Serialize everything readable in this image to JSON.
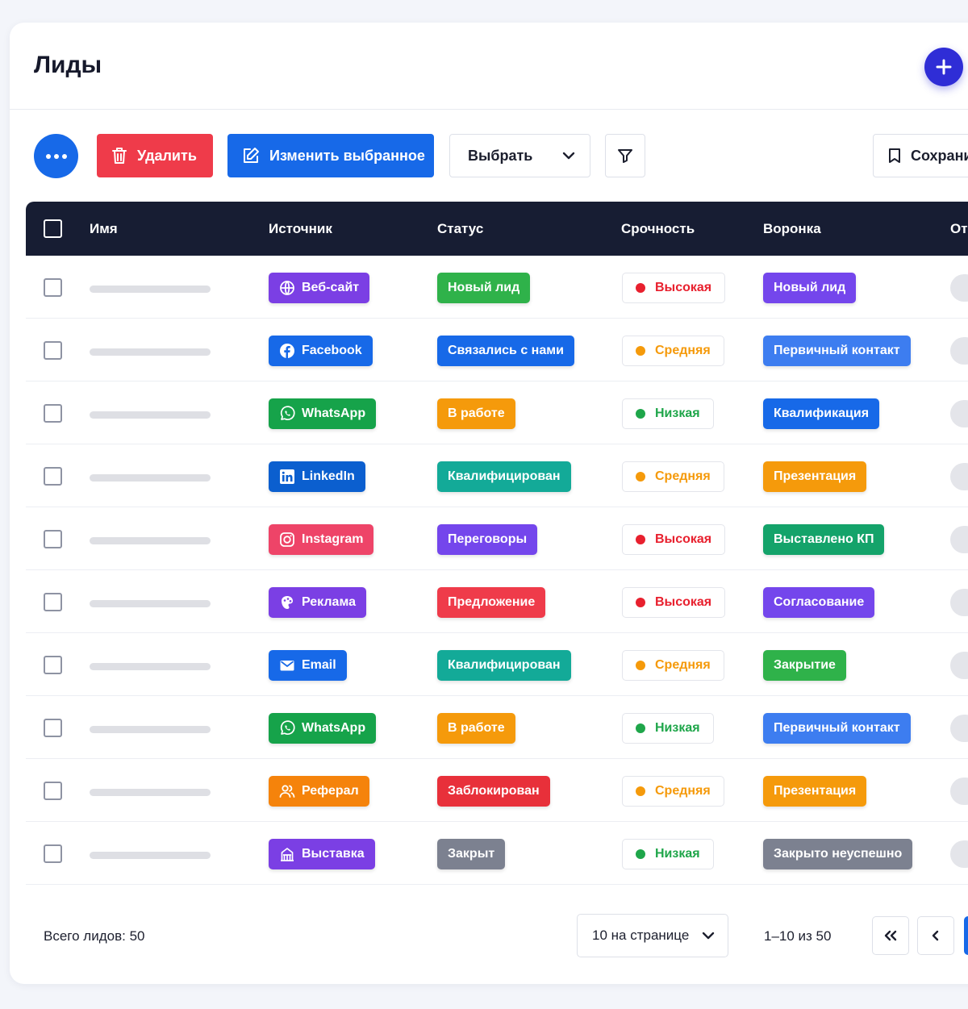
{
  "page": {
    "title": "Лиды"
  },
  "toolbar": {
    "delete_label": "Удалить",
    "edit_selected_label": "Изменить выбранное",
    "select_label": "Выбрать",
    "save_label": "Сохранить"
  },
  "table": {
    "columns": [
      "Имя",
      "Источник",
      "Статус",
      "Срочность",
      "Воронка",
      "Ответственный"
    ],
    "rows": [
      {
        "source": "Веб-сайт",
        "source_icon": "globe-icon",
        "source_color": "#7b3fe4",
        "status": "Новый лид",
        "status_color": "#2fb24a",
        "urgency": "Высокая",
        "urgency_color": "#e8202e",
        "funnel": "Новый лид",
        "funnel_color": "#7446ec"
      },
      {
        "source": "Facebook",
        "source_icon": "facebook-icon",
        "source_color": "#1769e8",
        "status": "Связались с нами",
        "status_color": "#1769e8",
        "urgency": "Средняя",
        "urgency_color": "#f59a0b",
        "funnel": "Первичный контакт",
        "funnel_color": "#3d7df0"
      },
      {
        "source": "WhatsApp",
        "source_icon": "whatsapp-icon",
        "source_color": "#16a34a",
        "status": "В работе",
        "status_color": "#f59a0b",
        "urgency": "Низкая",
        "urgency_color": "#1fa64a",
        "funnel": "Квалификация",
        "funnel_color": "#1769e8"
      },
      {
        "source": "LinkedIn",
        "source_icon": "linkedin-icon",
        "source_color": "#0b5fcf",
        "status": "Квалифицирован",
        "status_color": "#13aa98",
        "urgency": "Средняя",
        "urgency_color": "#f59a0b",
        "funnel": "Презентация",
        "funnel_color": "#f59a0b"
      },
      {
        "source": "Instagram",
        "source_icon": "instagram-icon",
        "source_color": "#ee4468",
        "status": "Переговоры",
        "status_color": "#7446ec",
        "urgency": "Высокая",
        "urgency_color": "#e8202e",
        "funnel": "Выставлено КП",
        "funnel_color": "#14a36a"
      },
      {
        "source": "Реклама",
        "source_icon": "megaphone-icon",
        "source_color": "#7b3fe4",
        "status": "Предложение",
        "status_color": "#ef3b4a",
        "urgency": "Высокая",
        "urgency_color": "#e8202e",
        "funnel": "Согласование",
        "funnel_color": "#7446ec"
      },
      {
        "source": "Email",
        "source_icon": "email-icon",
        "source_color": "#1769e8",
        "status": "Квалифицирован",
        "status_color": "#13aa98",
        "urgency": "Средняя",
        "urgency_color": "#f59a0b",
        "funnel": "Закрытие",
        "funnel_color": "#2fb24a"
      },
      {
        "source": "WhatsApp",
        "source_icon": "whatsapp-icon",
        "source_color": "#16a34a",
        "status": "В работе",
        "status_color": "#f59a0b",
        "urgency": "Низкая",
        "urgency_color": "#1fa64a",
        "funnel": "Первичный контакт",
        "funnel_color": "#3d7df0"
      },
      {
        "source": "Реферал",
        "source_icon": "users-icon",
        "source_color": "#f5830b",
        "status": "Заблокирован",
        "status_color": "#e8303a",
        "urgency": "Средняя",
        "urgency_color": "#f59a0b",
        "funnel": "Презентация",
        "funnel_color": "#f59a0b"
      },
      {
        "source": "Выставка",
        "source_icon": "building-icon",
        "source_color": "#7b3fe4",
        "status": "Закрыт",
        "status_color": "#7c8190",
        "urgency": "Низкая",
        "urgency_color": "#1fa64a",
        "funnel": "Закрыто неуспешно",
        "funnel_color": "#7c8190"
      }
    ]
  },
  "footer": {
    "total_label": "Всего лидов: 50",
    "per_page_label": "10 на странице",
    "range_label": "1–10 из 50"
  },
  "colors": {
    "accent": "#1769e8",
    "danger": "#ef3b4a",
    "header_bg": "#171d33",
    "add_button": "#2f2dd6"
  }
}
